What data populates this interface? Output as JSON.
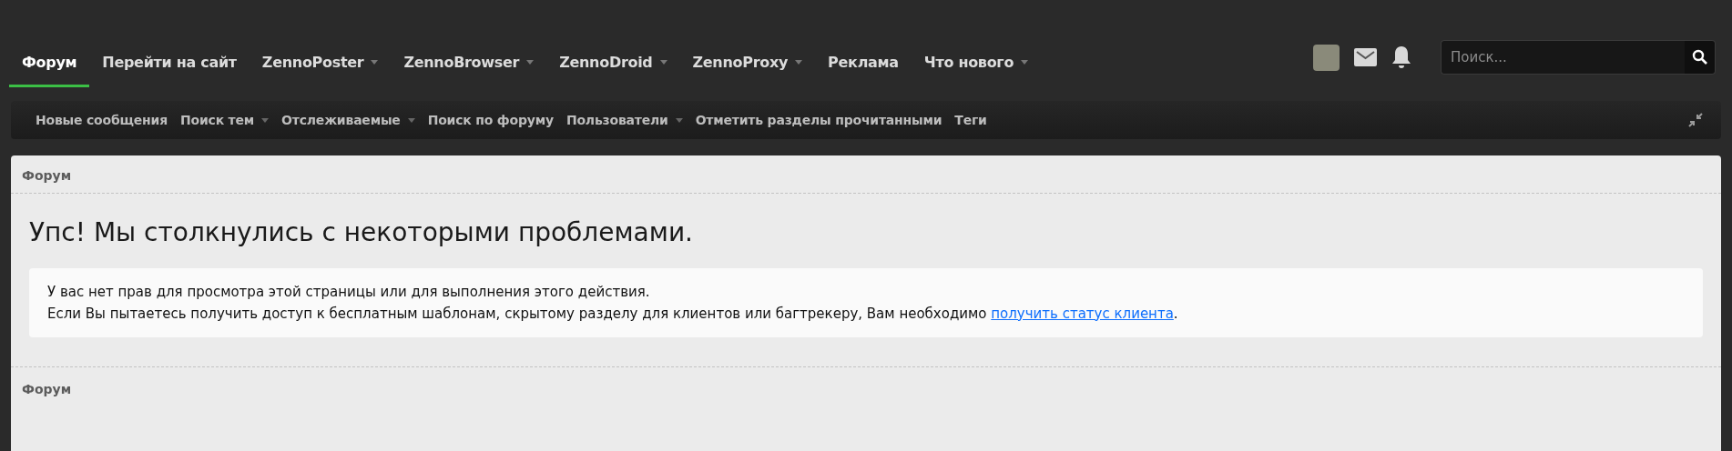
{
  "nav": {
    "tabs": [
      {
        "label": "Форум",
        "selected": true,
        "dropdown": false
      },
      {
        "label": "Перейти на сайт",
        "selected": false,
        "dropdown": false
      },
      {
        "label": "ZennoPoster",
        "selected": false,
        "dropdown": true
      },
      {
        "label": "ZennoBrowser",
        "selected": false,
        "dropdown": true
      },
      {
        "label": "ZennoDroid",
        "selected": false,
        "dropdown": true
      },
      {
        "label": "ZennoProxy",
        "selected": false,
        "dropdown": true
      },
      {
        "label": "Реклама",
        "selected": false,
        "dropdown": false
      },
      {
        "label": "Что нового",
        "selected": false,
        "dropdown": true
      }
    ],
    "search": {
      "placeholder": "Поиск..."
    }
  },
  "subnav": {
    "items": [
      {
        "label": "Новые сообщения",
        "dropdown": false
      },
      {
        "label": "Поиск тем",
        "dropdown": true
      },
      {
        "label": "Отслеживаемые",
        "dropdown": true
      },
      {
        "label": "Поиск по форуму",
        "dropdown": false
      },
      {
        "label": "Пользователи",
        "dropdown": true
      },
      {
        "label": "Отметить разделы прочитанными",
        "dropdown": false
      },
      {
        "label": "Теги",
        "dropdown": false
      }
    ]
  },
  "breadcrumb_top": "Форум",
  "error": {
    "title": "Упс! Мы столкнулись с некоторыми проблемами.",
    "lines": [
      "У вас нет прав для просмотра этой страницы или для выполнения этого действия.",
      "Если Вы пытаетесь получить доступ к бесплатным шаблонам, скрытому разделу для клиентов или багтрекеру, Вам необходимо"
    ],
    "link": "получить статус клиента",
    "after_link": "."
  },
  "breadcrumb_bottom": "Форум"
}
